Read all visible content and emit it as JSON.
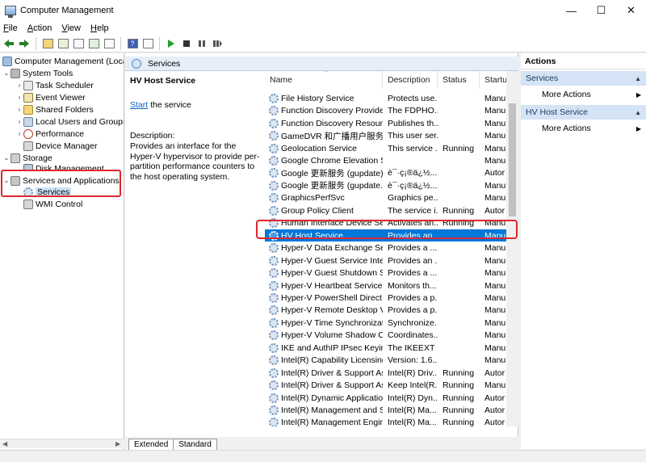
{
  "window": {
    "title": "Computer Management",
    "minimize": "—",
    "maximize": "☐",
    "close": "✕"
  },
  "menu": [
    {
      "label": "File",
      "accel": "F",
      "rest": "ile"
    },
    {
      "label": "Action",
      "accel": "A",
      "rest": "ction"
    },
    {
      "label": "View",
      "accel": "V",
      "rest": "iew"
    },
    {
      "label": "Help",
      "accel": "H",
      "rest": "elp"
    }
  ],
  "tree": {
    "root": "Computer Management (Local",
    "system_tools": "System Tools",
    "task_scheduler": "Task Scheduler",
    "event_viewer": "Event Viewer",
    "shared_folders": "Shared Folders",
    "local_users": "Local Users and Groups",
    "performance": "Performance",
    "device_manager": "Device Manager",
    "storage": "Storage",
    "disk_management": "Disk Management",
    "services_apps": "Services and Applications",
    "services": "Services",
    "wmi": "WMI Control"
  },
  "main": {
    "header": "Services",
    "selected_service": "HV Host Service",
    "start_link": "Start",
    "start_rest": " the service",
    "description_label": "Description:",
    "description_text": "Provides an interface for the Hyper-V hypervisor to provide per-partition performance counters to the host operating system.",
    "columns": {
      "name": "Name",
      "description": "Description",
      "status": "Status",
      "startup": "Startu"
    }
  },
  "services": [
    {
      "name": "File History Service",
      "desc": "Protects use...",
      "status": "",
      "startup": "Manu"
    },
    {
      "name": "Function Discovery Provide...",
      "desc": "The FDPHO...",
      "status": "",
      "startup": "Manu"
    },
    {
      "name": "Function Discovery Resourc...",
      "desc": "Publishes th...",
      "status": "",
      "startup": "Manu"
    },
    {
      "name": "GameDVR 和广播用户服务...",
      "desc": "This user ser...",
      "status": "",
      "startup": "Manu"
    },
    {
      "name": "Geolocation Service",
      "desc": "This service ...",
      "status": "Running",
      "startup": "Manu"
    },
    {
      "name": "Google Chrome Elevation S...",
      "desc": "",
      "status": "",
      "startup": "Manu"
    },
    {
      "name": "Google 更新服务 (gupdate)",
      "desc": "è¯·ç¡®ä¿½...",
      "status": "",
      "startup": "Autor"
    },
    {
      "name": "Google 更新服务 (gupdate...",
      "desc": "è¯·ç¡®ä¿½...",
      "status": "",
      "startup": "Manu"
    },
    {
      "name": "GraphicsPerfSvc",
      "desc": "Graphics pe...",
      "status": "",
      "startup": "Manu"
    },
    {
      "name": "Group Policy Client",
      "desc": "The service i...",
      "status": "Running",
      "startup": "Autor"
    },
    {
      "name": "Human Interface Device Ser...",
      "desc": "Activates an...",
      "status": "Running",
      "startup": "Manu"
    },
    {
      "name": "HV Host Service",
      "desc": "Provides an ...",
      "status": "",
      "startup": "Manu"
    },
    {
      "name": "Hyper-V Data Exchange Ser...",
      "desc": "Provides a ...",
      "status": "",
      "startup": "Manu"
    },
    {
      "name": "Hyper-V Guest Service Inter...",
      "desc": "Provides an ...",
      "status": "",
      "startup": "Manu"
    },
    {
      "name": "Hyper-V Guest Shutdown S...",
      "desc": "Provides a ...",
      "status": "",
      "startup": "Manu"
    },
    {
      "name": "Hyper-V Heartbeat Service",
      "desc": "Monitors th...",
      "status": "",
      "startup": "Manu"
    },
    {
      "name": "Hyper-V PowerShell Direct ...",
      "desc": "Provides a p...",
      "status": "",
      "startup": "Manu"
    },
    {
      "name": "Hyper-V Remote Desktop Vi...",
      "desc": "Provides a p...",
      "status": "",
      "startup": "Manu"
    },
    {
      "name": "Hyper-V Time Synchronizati...",
      "desc": "Synchronize...",
      "status": "",
      "startup": "Manu"
    },
    {
      "name": "Hyper-V Volume Shadow C...",
      "desc": "Coordinates...",
      "status": "",
      "startup": "Manu"
    },
    {
      "name": "IKE and AuthIP IPsec Keying...",
      "desc": "The IKEEXT ...",
      "status": "",
      "startup": "Manu"
    },
    {
      "name": "Intel(R) Capability Licensing...",
      "desc": "Version: 1.6...",
      "status": "",
      "startup": "Manu"
    },
    {
      "name": "Intel(R) Driver & Support As...",
      "desc": "Intel(R) Driv...",
      "status": "Running",
      "startup": "Autor"
    },
    {
      "name": "Intel(R) Driver & Support As...",
      "desc": "Keep Intel(R...",
      "status": "Running",
      "startup": "Manu"
    },
    {
      "name": "Intel(R) Dynamic Applicatio...",
      "desc": "Intel(R) Dyn...",
      "status": "Running",
      "startup": "Autor"
    },
    {
      "name": "Intel(R) Management and S...",
      "desc": "Intel(R) Ma...",
      "status": "Running",
      "startup": "Autor"
    },
    {
      "name": "Intel(R) Management Engin...",
      "desc": "Intel(R) Ma...",
      "status": "Running",
      "startup": "Autor"
    }
  ],
  "tabs": {
    "extended": "Extended",
    "standard": "Standard"
  },
  "actions": {
    "title": "Actions",
    "section1": "Services",
    "more1": "More Actions",
    "section2": "HV Host Service",
    "more2": "More Actions"
  },
  "colors": {
    "selection": "#0078d7",
    "highlight": "#e0262f",
    "section": "#d4e3f5"
  }
}
